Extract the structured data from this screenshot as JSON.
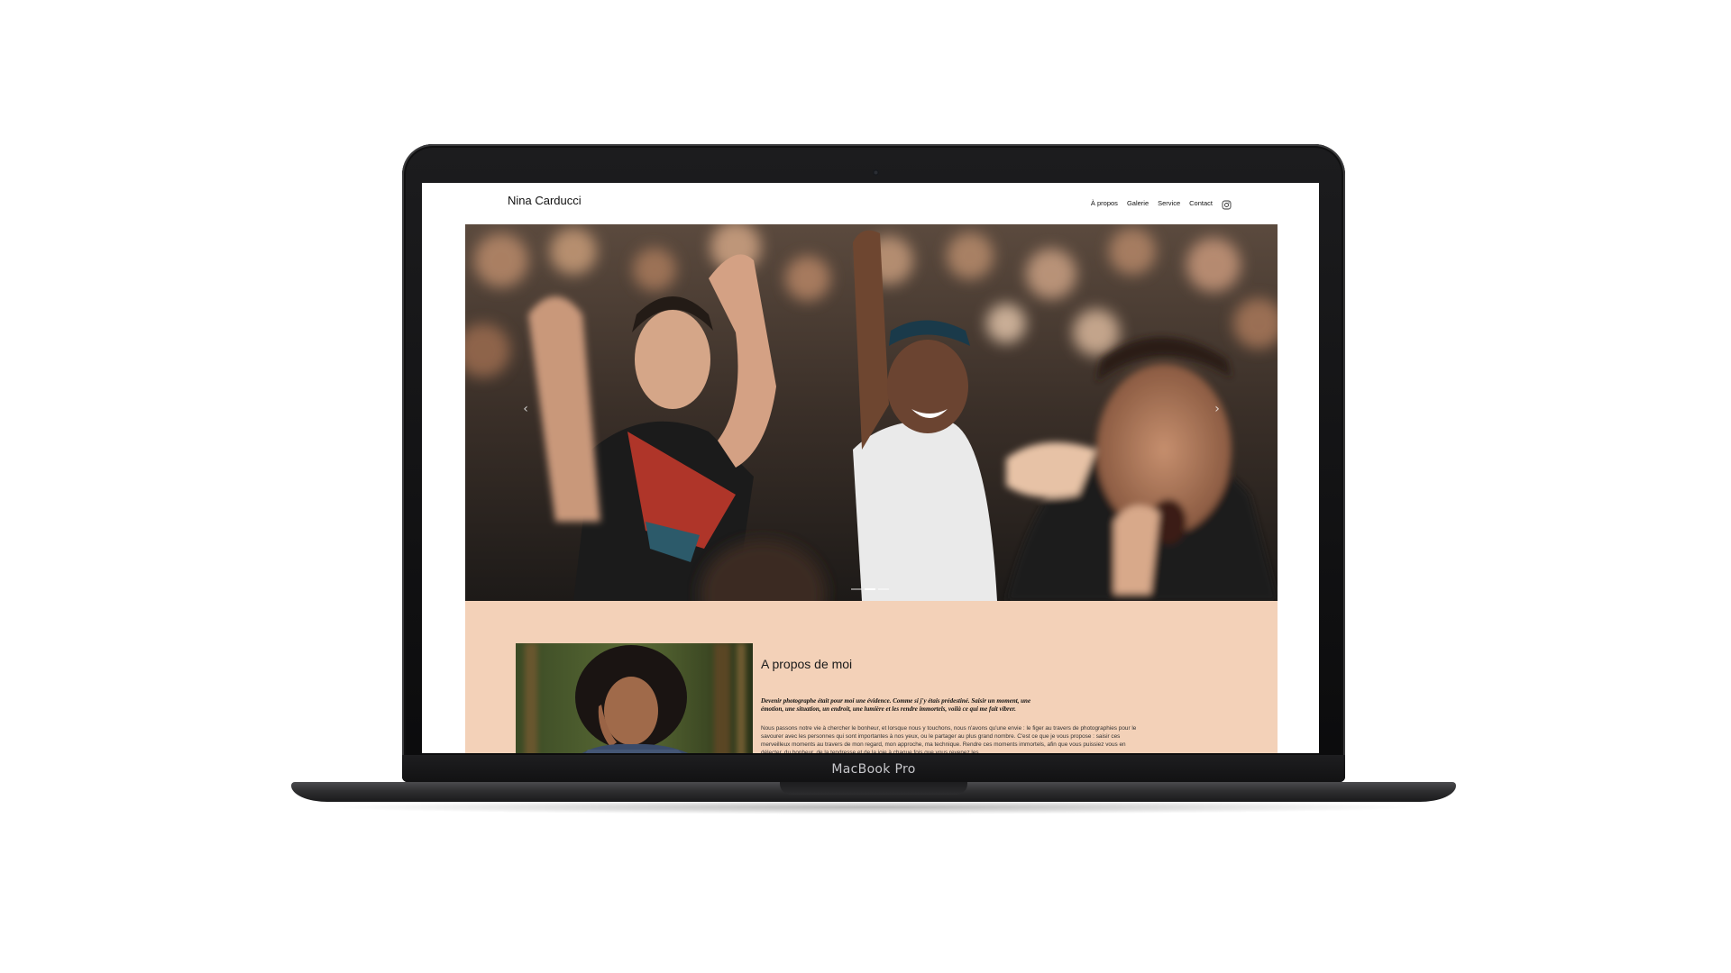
{
  "device": {
    "model_label": "MacBook Pro"
  },
  "site": {
    "brand": "Nina Carducci",
    "nav": [
      {
        "label": "À propos"
      },
      {
        "label": "Galerie"
      },
      {
        "label": "Service"
      },
      {
        "label": "Contact"
      }
    ],
    "social_icon": "instagram-icon"
  },
  "hero": {
    "prev_icon": "‹",
    "next_icon": "›",
    "slide_count": 3,
    "active_slide": 2
  },
  "about": {
    "title": "A propos de moi",
    "lead": "Devenir photographe était pour moi une évidence. Comme si j'y étais prédestiné. Saisir un moment, une émotion, une situation, un endroit, une lumière et les rendre immortels, voilà ce qui me fait vibrer.",
    "body": "Nous passons notre vie à chercher le bonheur, et lorsque nous y touchons, nous n'avons qu'une envie : le figer au travers de photographies pour le savourer avec les personnes qui sont importantes à nos yeux, ou le partager au plus grand nombre. C'est ce que je vous propose : saisir ces merveilleux moments au travers de mon regard, mon approche, ma technique. Rendre ces moments immortels, afin que vous puissiez vous en délecter, du bonheur, de la tendresse et de la joie à chaque fois que vous revenez les"
  },
  "colors": {
    "about_bg": "#f3d1b8",
    "frame": "#1c1c1e"
  }
}
